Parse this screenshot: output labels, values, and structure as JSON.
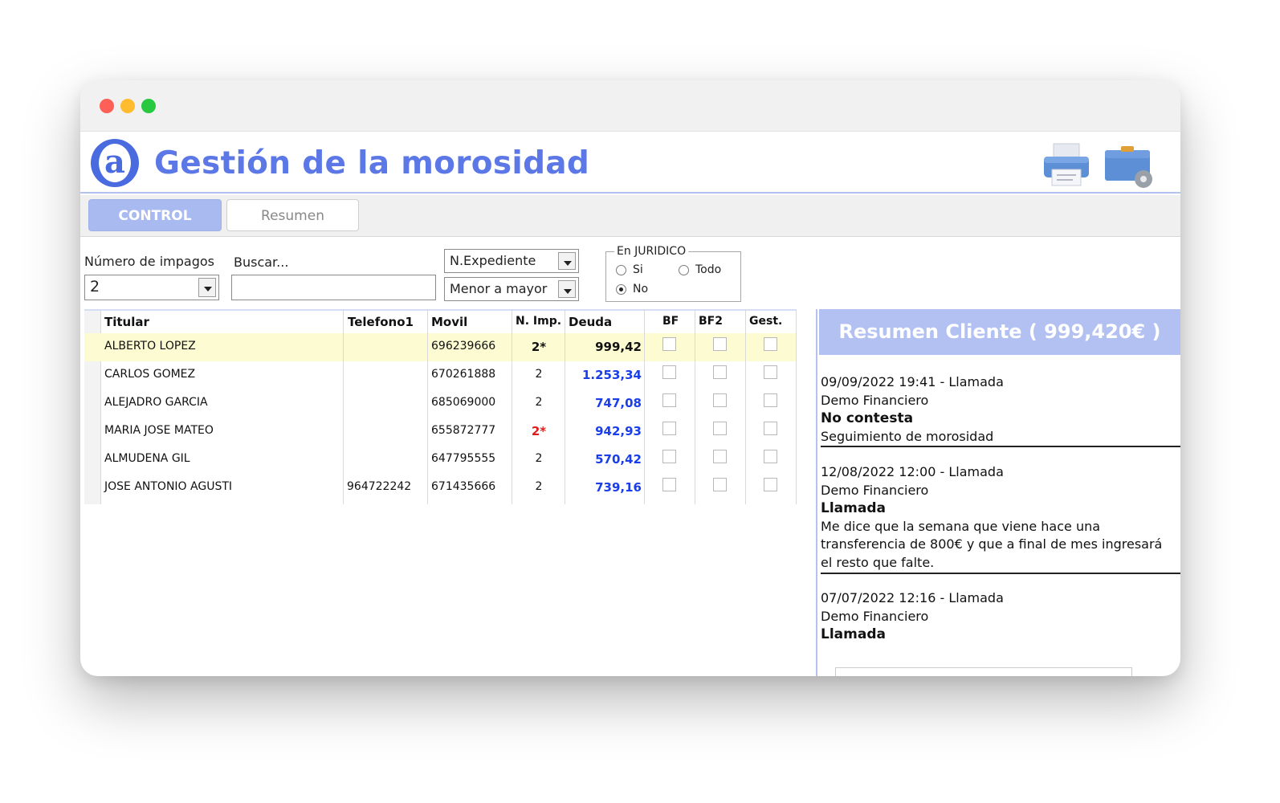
{
  "app": {
    "title": "Gestión de la morosidad"
  },
  "tabs": [
    {
      "label": "CONTROL",
      "active": true
    },
    {
      "label": "Resumen",
      "active": false
    }
  ],
  "filters": {
    "impagos_label": "Número de impagos",
    "impagos_value": "2",
    "buscar_label": "Buscar...",
    "buscar_value": "",
    "order_field": "N.Expediente",
    "order_direction": "Menor a mayor",
    "juridico": {
      "legend": "En JURIDICO",
      "options": [
        "Si",
        "Todo",
        "No"
      ],
      "selected": "No"
    }
  },
  "table": {
    "columns": [
      "Titular",
      "Telefono1",
      "Movil",
      "N. Imp.",
      "Deuda",
      "BF",
      "BF2",
      "Gest."
    ],
    "rows": [
      {
        "titular": "ALBERTO LOPEZ",
        "telefono1": "",
        "movil": "696239666",
        "nimp": "2*",
        "deuda": "999,42",
        "selected": true
      },
      {
        "titular": "CARLOS GOMEZ",
        "telefono1": "",
        "movil": "670261888",
        "nimp": "2",
        "deuda": "1.253,34"
      },
      {
        "titular": "ALEJADRO GARCIA",
        "telefono1": "",
        "movil": "685069000",
        "nimp": "2",
        "deuda": "747,08"
      },
      {
        "titular": "MARIA JOSE MATEO",
        "telefono1": "",
        "movil": "655872777",
        "nimp": "2*",
        "deuda": "942,93"
      },
      {
        "titular": "ALMUDENA GIL",
        "telefono1": "",
        "movil": "647795555",
        "nimp": "2",
        "deuda": "570,42"
      },
      {
        "titular": "JOSE ANTONIO AGUSTI",
        "telefono1": "964722242",
        "movil": "671435666",
        "nimp": "2",
        "deuda": "739,16"
      }
    ]
  },
  "resumen": {
    "title": "Resumen Cliente ( 999,420€ )",
    "entries": [
      {
        "header": "09/09/2022 19:41 - Llamada",
        "user": "Demo Financiero",
        "result": "No contesta",
        "note": "Seguimiento de morosidad"
      },
      {
        "header": "12/08/2022 12:00 - Llamada",
        "user": "Demo Financiero",
        "result": "Llamada",
        "note_lines": [
          "Me dice que la semana que viene hace una",
          "transferencia de 800€ y que a final de mes ingresará",
          "el resto que falte."
        ]
      },
      {
        "header": "07/07/2022 12:16 - Llamada",
        "user": "Demo Financiero",
        "result": "Llamada"
      }
    ]
  },
  "colors": {
    "accent": "#5b78e6",
    "tab_active": "#a9baf0",
    "amount_blue": "#1a3ee8",
    "alert_red": "#e01b1b",
    "selected_row": "#fcfbd2"
  },
  "icons": [
    "logo-icon",
    "printer-icon",
    "settings-folder-icon"
  ]
}
